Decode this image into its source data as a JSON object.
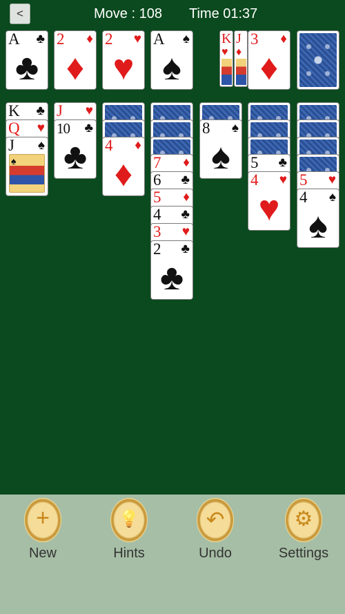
{
  "header": {
    "back_label": "<",
    "move": "Move : 108",
    "time": "Time 01:37"
  },
  "foundations": [
    {
      "rank": "A",
      "suit": "♣",
      "color": "black"
    },
    {
      "rank": "2",
      "suit": "♦",
      "color": "red"
    },
    {
      "rank": "2",
      "suit": "♥",
      "color": "red"
    },
    {
      "rank": "A",
      "suit": "♠",
      "color": "black"
    }
  ],
  "waste": {
    "slivers": [
      {
        "rank": "K",
        "suit": "♥"
      },
      {
        "rank": "J",
        "suit": "♦"
      }
    ],
    "top": {
      "rank": "3",
      "suit": "♦"
    }
  },
  "tableau": [
    {
      "cards": [
        {
          "rank": "K",
          "suit": "♣",
          "color": "black"
        },
        {
          "rank": "Q",
          "suit": "♥",
          "color": "red"
        },
        {
          "rank": "J",
          "suit": "♠",
          "color": "black"
        }
      ]
    },
    {
      "cards": [
        {
          "rank": "J",
          "suit": "♥",
          "color": "red"
        },
        {
          "rank": "10",
          "suit": "♣",
          "color": "black"
        }
      ]
    },
    {
      "cards": [
        {
          "rank": "4",
          "suit": "♦",
          "color": "red"
        }
      ]
    },
    {
      "cards": [
        {
          "rank": "7",
          "suit": "♦",
          "color": "red"
        },
        {
          "rank": "6",
          "suit": "♣",
          "color": "black"
        },
        {
          "rank": "5",
          "suit": "♦",
          "color": "red"
        },
        {
          "rank": "4",
          "suit": "♣",
          "color": "black"
        },
        {
          "rank": "3",
          "suit": "♥",
          "color": "red"
        },
        {
          "rank": "2",
          "suit": "♣",
          "color": "black"
        }
      ]
    },
    {
      "cards": [
        {
          "rank": "8",
          "suit": "♠",
          "color": "black"
        }
      ]
    },
    {
      "cards": [
        {
          "rank": "5",
          "suit": "♣",
          "color": "black"
        },
        {
          "rank": "4",
          "suit": "♥",
          "color": "red"
        }
      ]
    },
    {
      "cards": [
        {
          "rank": "5",
          "suit": "♥",
          "color": "red"
        },
        {
          "rank": "4",
          "suit": "♠",
          "color": "black"
        }
      ]
    }
  ],
  "buttons": [
    {
      "icon": "plus-icon",
      "glyph": "+",
      "label": "New"
    },
    {
      "icon": "lightbulb-icon",
      "glyph": "💡",
      "label": "Hints"
    },
    {
      "icon": "undo-icon",
      "glyph": "↶",
      "label": "Undo"
    },
    {
      "icon": "gear-icon",
      "glyph": "⚙",
      "label": "Settings"
    }
  ],
  "colors": {
    "felt": "#0a4a1e",
    "toolbar": "#a6bea5",
    "red_suit": "#e01b1b",
    "black_suit": "#111111"
  }
}
